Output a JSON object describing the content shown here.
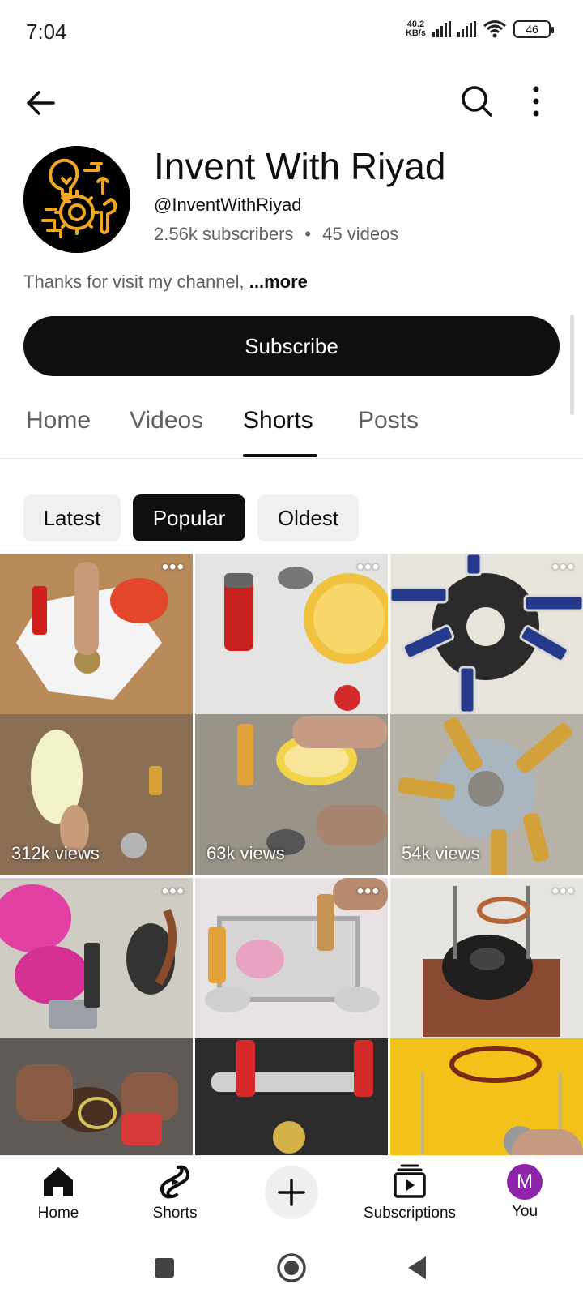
{
  "status_bar": {
    "time": "7:04",
    "net_speed_value": "40.2",
    "net_speed_unit": "KB/s",
    "battery": "46"
  },
  "channel": {
    "name": "Invent With Riyad",
    "handle": "@InventWithRiyad",
    "subscribers": "2.56k subscribers",
    "separator": "•",
    "videos": "45 videos",
    "description": "Thanks for visit my channel, ",
    "more_label": "...more",
    "subscribe_label": "Subscribe"
  },
  "tabs": [
    {
      "label": "Home"
    },
    {
      "label": "Videos"
    },
    {
      "label": "Shorts",
      "active": true
    },
    {
      "label": "Posts"
    }
  ],
  "filters": [
    {
      "label": "Latest"
    },
    {
      "label": "Popular",
      "selected": true
    },
    {
      "label": "Oldest"
    }
  ],
  "shorts": [
    {
      "views": "312k views",
      "menu": "•••"
    },
    {
      "views": "63k views",
      "menu": "•••"
    },
    {
      "views": "54k views",
      "menu": "•••"
    },
    {
      "views": "",
      "menu": "•••"
    },
    {
      "views": "",
      "menu": "•••"
    },
    {
      "views": "",
      "menu": "•••"
    }
  ],
  "bottom_nav": {
    "home": "Home",
    "shorts": "Shorts",
    "subscriptions": "Subscriptions",
    "you": "You",
    "you_initial": "M"
  },
  "colors": {
    "primary": "#0f0f0f",
    "secondary_text": "#606060",
    "chip_bg": "#f0f0f0",
    "avatar_gold": "#f2a81d",
    "you_avatar": "#8e24aa"
  }
}
